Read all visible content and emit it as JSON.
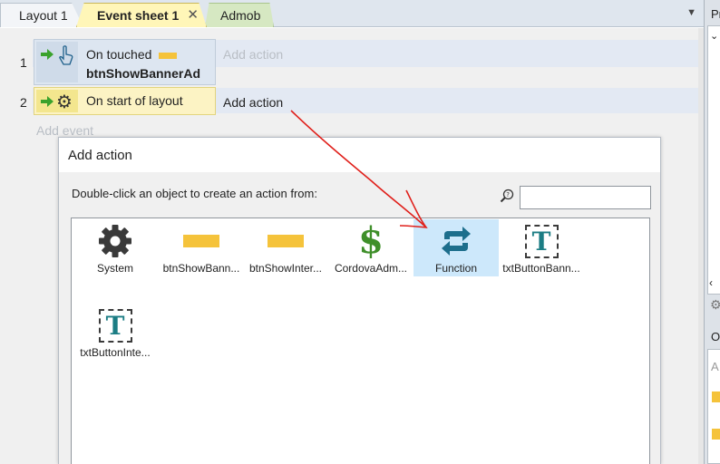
{
  "tabs": [
    {
      "label": "Layout 1"
    },
    {
      "label": "Event sheet 1",
      "close": "✕"
    },
    {
      "label": "Admob"
    }
  ],
  "tab_menu_icon": "dropdown-triangle-icon",
  "events": [
    {
      "number": "1",
      "condition": "On touched",
      "object": "btnShowBannerAd",
      "action": "Add action"
    },
    {
      "number": "2",
      "condition": "On start of layout",
      "action": "Add action"
    }
  ],
  "add_event": "Add event",
  "right_panel": {
    "label_top": "Pr",
    "label_mid": "O",
    "label_a": "A"
  },
  "dialog": {
    "title": "Add action",
    "prompt": "Double-click an object to create an action from:",
    "search_value": "",
    "objects": [
      {
        "label": "System",
        "icon": "gear-icon"
      },
      {
        "label": "btnShowBann...",
        "icon": "sprite-yellow-icon"
      },
      {
        "label": "btnShowInter...",
        "icon": "sprite-yellow-icon"
      },
      {
        "label": "CordovaAdm...",
        "icon": "dollar-icon"
      },
      {
        "label": "Function",
        "icon": "function-arrows-icon",
        "selected": true
      },
      {
        "label": "txtButtonBann...",
        "icon": "text-object-icon"
      },
      {
        "label": "txtButtonInte...",
        "icon": "text-object-icon"
      }
    ]
  },
  "colors": {
    "event_bar": "#e3e9f3",
    "condition_blue": "#dde6f1",
    "condition_yellow": "#fcf3c4",
    "selected_object": "#cde8fb",
    "annotation_red": "#e0201b"
  }
}
